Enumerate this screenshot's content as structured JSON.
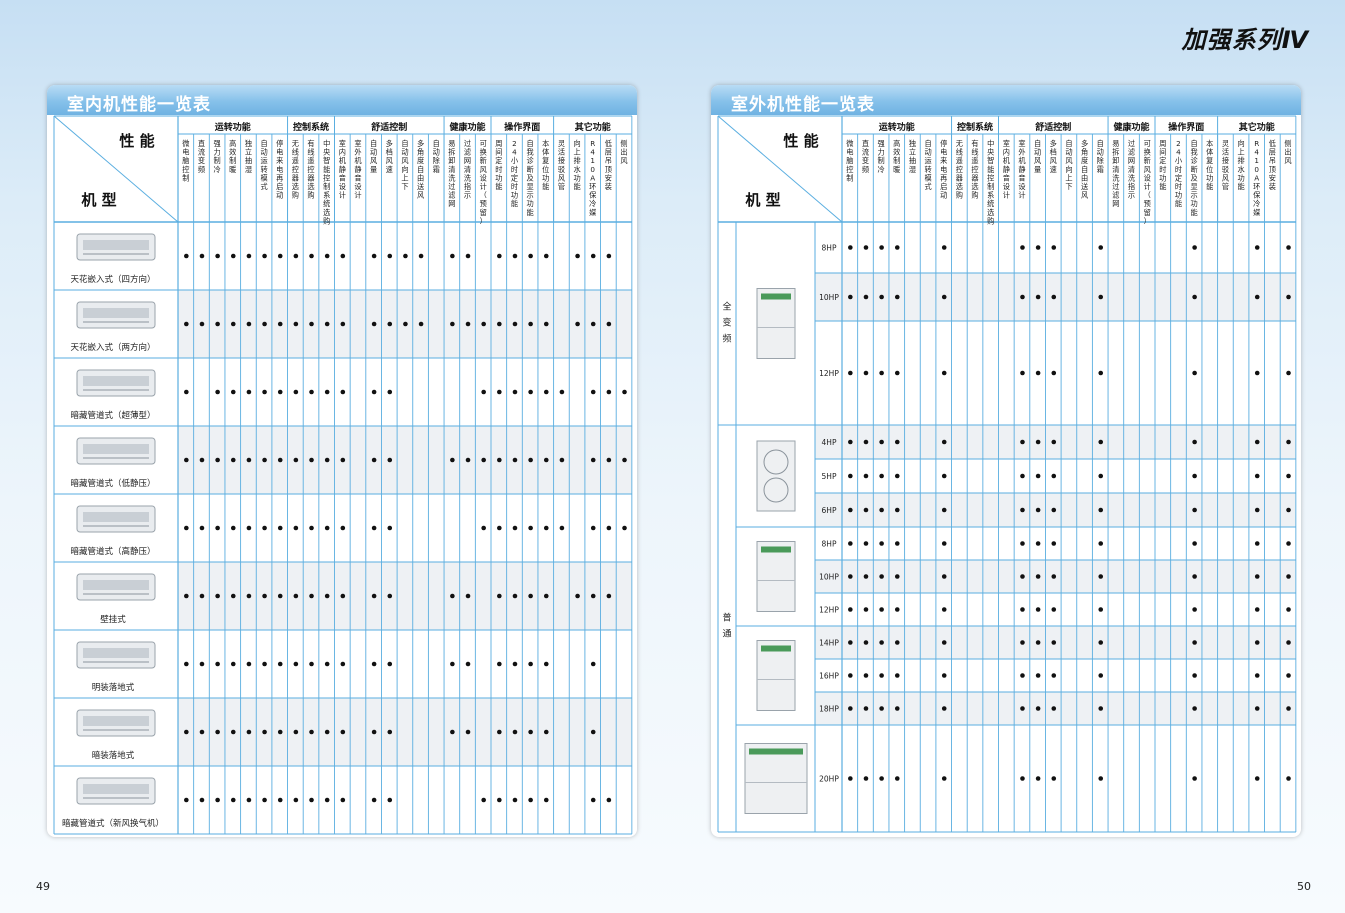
{
  "brand": "加强系列Ⅳ",
  "page_left": "49",
  "page_right": "50",
  "header": {
    "perf": "性 能",
    "model": "机 型"
  },
  "groups": [
    {
      "name": "运转功能",
      "n": 7
    },
    {
      "name": "控制系统",
      "n": 3
    },
    {
      "name": "舒适控制",
      "n": 7
    },
    {
      "name": "健康功能",
      "n": 3
    },
    {
      "name": "操作界面",
      "n": 4
    },
    {
      "name": "其它功能",
      "n": 5
    }
  ],
  "features": [
    "微电脑控制",
    "直流变频",
    "强力制冷",
    "高效制暖",
    "独立抽湿",
    "自动运转模式",
    "停电来电再启动",
    "无线遥控器选购",
    "有线遥控器选购",
    "中央智能控制系统选购",
    "室内机静音设计",
    "室外机静音设计",
    "自动风量",
    "多档风速",
    "自动风向上下",
    "多角度自由送风",
    "自动除霜",
    "易拆卸清洗过滤网",
    "过滤网清洗指示",
    "可换新风设计（预留）",
    "周间定时功能",
    "24小时定时功能",
    "自我诊断及显示功能",
    "本体复位功能",
    "灵活接驳风管",
    "向上排水功能",
    "R410A环保冷媒",
    "低层吊顶安装",
    "侧出风"
  ],
  "indoor": {
    "title": "室内机性能一览表",
    "rows": [
      {
        "name": "天花嵌入式（四方向）",
        "icon": "cassette-4way-icon",
        "dots": [
          1,
          1,
          1,
          1,
          1,
          1,
          1,
          1,
          1,
          1,
          1,
          0,
          1,
          1,
          1,
          1,
          0,
          1,
          1,
          0,
          1,
          1,
          1,
          1,
          0,
          1,
          1,
          1,
          0
        ]
      },
      {
        "name": "天花嵌入式（两方向）",
        "icon": "cassette-2way-icon",
        "dots": [
          1,
          1,
          1,
          1,
          1,
          1,
          1,
          1,
          1,
          1,
          1,
          0,
          1,
          1,
          1,
          1,
          0,
          1,
          1,
          1,
          1,
          1,
          1,
          1,
          0,
          1,
          1,
          1,
          0
        ]
      },
      {
        "name": "暗藏管道式（超薄型）",
        "icon": "duct-slim-icon",
        "dots": [
          1,
          0,
          1,
          1,
          1,
          1,
          1,
          1,
          1,
          1,
          1,
          0,
          1,
          1,
          0,
          0,
          0,
          0,
          0,
          1,
          1,
          1,
          1,
          1,
          1,
          0,
          1,
          1,
          1
        ]
      },
      {
        "name": "暗藏管道式（低静压）",
        "icon": "duct-low-static-icon",
        "dots": [
          1,
          1,
          1,
          1,
          1,
          1,
          1,
          1,
          1,
          1,
          1,
          0,
          1,
          1,
          0,
          0,
          0,
          1,
          1,
          1,
          1,
          1,
          1,
          1,
          1,
          0,
          1,
          1,
          1
        ]
      },
      {
        "name": "暗藏管道式（高静压）",
        "icon": "duct-high-static-icon",
        "dots": [
          1,
          1,
          1,
          1,
          1,
          1,
          1,
          1,
          1,
          1,
          1,
          0,
          1,
          1,
          0,
          0,
          0,
          0,
          0,
          1,
          1,
          1,
          1,
          1,
          1,
          0,
          1,
          1,
          1
        ]
      },
      {
        "name": "壁挂式",
        "icon": "wall-mounted-icon",
        "dots": [
          1,
          1,
          1,
          1,
          1,
          1,
          1,
          1,
          1,
          1,
          1,
          0,
          1,
          1,
          0,
          0,
          0,
          1,
          1,
          0,
          1,
          1,
          1,
          1,
          0,
          1,
          1,
          1,
          0
        ]
      },
      {
        "name": "明装落地式",
        "icon": "floor-exposed-icon",
        "dots": [
          1,
          1,
          1,
          1,
          1,
          1,
          1,
          1,
          1,
          1,
          1,
          0,
          1,
          1,
          0,
          0,
          0,
          1,
          1,
          0,
          1,
          1,
          1,
          1,
          0,
          0,
          1,
          0,
          0
        ]
      },
      {
        "name": "暗装落地式",
        "icon": "floor-concealed-icon",
        "dots": [
          1,
          1,
          1,
          1,
          1,
          1,
          1,
          1,
          1,
          1,
          1,
          0,
          1,
          1,
          0,
          0,
          0,
          1,
          1,
          0,
          1,
          1,
          1,
          1,
          0,
          0,
          1,
          0,
          0
        ]
      },
      {
        "name": "暗藏管道式（新风换气机）",
        "icon": "duct-fresh-air-icon",
        "dots": [
          1,
          1,
          1,
          1,
          1,
          1,
          1,
          1,
          1,
          1,
          1,
          0,
          1,
          1,
          0,
          0,
          0,
          0,
          0,
          1,
          1,
          1,
          1,
          1,
          0,
          0,
          1,
          1,
          0
        ]
      }
    ]
  },
  "outdoor": {
    "title": "室外机性能一览表",
    "features": [
      "微电脑控制",
      "直流变频",
      "强力制冷",
      "高效制暖",
      "独立抽湿",
      "自动运转模式",
      "停电来电再启动",
      "无线遥控器选购",
      "有线遥控器选购",
      "中央智能控制系统选购",
      "室内机静音设计",
      "室外机静音设计",
      "自动风量",
      "多档风速",
      "自动风向上下",
      "多角度自由送风",
      "自动除霜",
      "易拆卸清洗过滤网",
      "过滤网清洗指示",
      "可换新风设计（预留）",
      "周间定时功能",
      "24小时定时功能",
      "自我诊断及显示功能",
      "本体复位功能",
      "灵活接驳风管",
      "向上排水功能",
      "R410A环保冷媒",
      "低层吊顶安装",
      "侧出风"
    ],
    "cats": [
      {
        "name": "全变频"
      },
      {
        "name": "普通"
      }
    ],
    "rows": [
      {
        "hp": "8HP",
        "dots": [
          1,
          1,
          1,
          1,
          0,
          0,
          1,
          0,
          0,
          0,
          0,
          1,
          1,
          1,
          0,
          0,
          1,
          0,
          0,
          0,
          0,
          0,
          1,
          0,
          0,
          0,
          1,
          0,
          1
        ]
      },
      {
        "hp": "10HP",
        "dots": [
          1,
          1,
          1,
          1,
          0,
          0,
          1,
          0,
          0,
          0,
          0,
          1,
          1,
          1,
          0,
          0,
          1,
          0,
          0,
          0,
          0,
          0,
          1,
          0,
          0,
          0,
          1,
          0,
          1
        ]
      },
      {
        "hp": "12HP",
        "dots": [
          1,
          1,
          1,
          1,
          0,
          0,
          1,
          0,
          0,
          0,
          0,
          1,
          1,
          1,
          0,
          0,
          1,
          0,
          0,
          0,
          0,
          0,
          1,
          0,
          0,
          0,
          1,
          0,
          1
        ]
      },
      {
        "hp": "4HP",
        "dots": [
          1,
          1,
          1,
          1,
          0,
          0,
          1,
          0,
          0,
          0,
          0,
          1,
          1,
          1,
          0,
          0,
          1,
          0,
          0,
          0,
          0,
          0,
          1,
          0,
          0,
          0,
          1,
          0,
          1
        ]
      },
      {
        "hp": "5HP",
        "dots": [
          1,
          1,
          1,
          1,
          0,
          0,
          1,
          0,
          0,
          0,
          0,
          1,
          1,
          1,
          0,
          0,
          1,
          0,
          0,
          0,
          0,
          0,
          1,
          0,
          0,
          0,
          1,
          0,
          1
        ]
      },
      {
        "hp": "6HP",
        "dots": [
          1,
          1,
          1,
          1,
          0,
          0,
          1,
          0,
          0,
          0,
          0,
          1,
          1,
          1,
          0,
          0,
          1,
          0,
          0,
          0,
          0,
          0,
          1,
          0,
          0,
          0,
          1,
          0,
          1
        ]
      },
      {
        "hp": "8HP",
        "dots": [
          1,
          1,
          1,
          1,
          0,
          0,
          1,
          0,
          0,
          0,
          0,
          1,
          1,
          1,
          0,
          0,
          1,
          0,
          0,
          0,
          0,
          0,
          1,
          0,
          0,
          0,
          1,
          0,
          1
        ]
      },
      {
        "hp": "10HP",
        "dots": [
          1,
          1,
          1,
          1,
          0,
          0,
          1,
          0,
          0,
          0,
          0,
          1,
          1,
          1,
          0,
          0,
          1,
          0,
          0,
          0,
          0,
          0,
          1,
          0,
          0,
          0,
          1,
          0,
          1
        ]
      },
      {
        "hp": "12HP",
        "dots": [
          1,
          1,
          1,
          1,
          0,
          0,
          1,
          0,
          0,
          0,
          0,
          1,
          1,
          1,
          0,
          0,
          1,
          0,
          0,
          0,
          0,
          0,
          1,
          0,
          0,
          0,
          1,
          0,
          1
        ]
      },
      {
        "hp": "14HP",
        "dots": [
          1,
          1,
          1,
          1,
          0,
          0,
          1,
          0,
          0,
          0,
          0,
          1,
          1,
          1,
          0,
          0,
          1,
          0,
          0,
          0,
          0,
          0,
          1,
          0,
          0,
          0,
          1,
          0,
          1
        ]
      },
      {
        "hp": "16HP",
        "dots": [
          1,
          1,
          1,
          1,
          0,
          0,
          1,
          0,
          0,
          0,
          0,
          1,
          1,
          1,
          0,
          0,
          1,
          0,
          0,
          0,
          0,
          0,
          1,
          0,
          0,
          0,
          1,
          0,
          1
        ]
      },
      {
        "hp": "18HP",
        "dots": [
          1,
          1,
          1,
          1,
          0,
          0,
          1,
          0,
          0,
          0,
          0,
          1,
          1,
          1,
          0,
          0,
          1,
          0,
          0,
          0,
          0,
          0,
          1,
          0,
          0,
          0,
          1,
          0,
          1
        ]
      },
      {
        "hp": "20HP",
        "dots": [
          1,
          1,
          1,
          1,
          0,
          0,
          1,
          0,
          0,
          0,
          0,
          1,
          1,
          1,
          0,
          0,
          1,
          0,
          0,
          0,
          0,
          0,
          1,
          0,
          0,
          0,
          1,
          0,
          1
        ]
      }
    ]
  },
  "colors": {
    "line": "#5aaee0",
    "rowAlt": "#eef1f4",
    "dot": "#111111"
  }
}
